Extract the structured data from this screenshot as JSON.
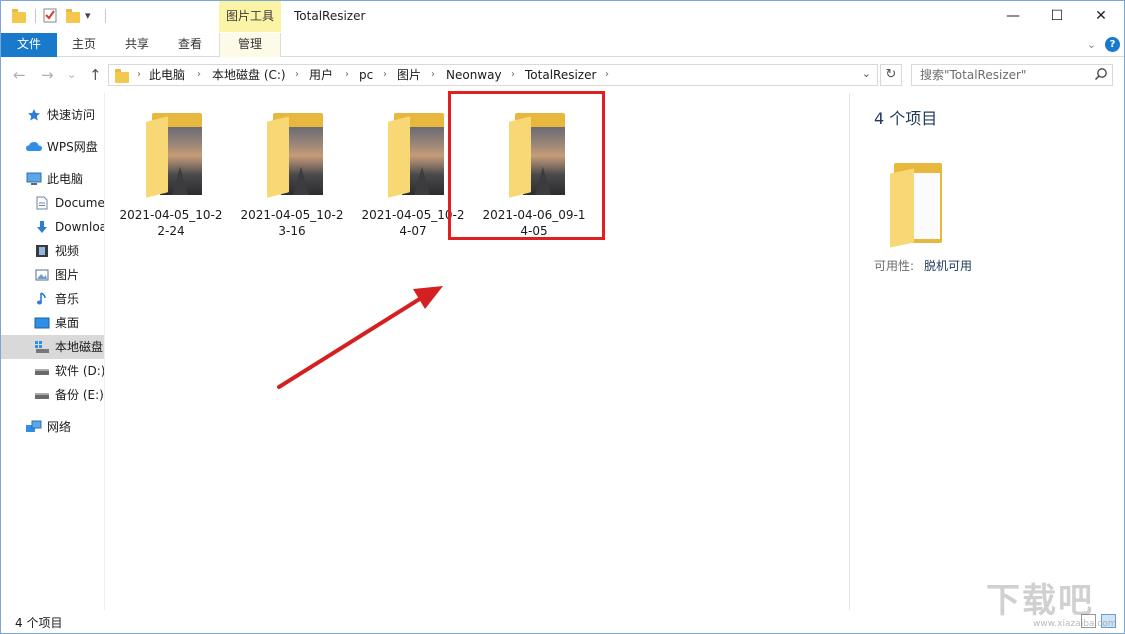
{
  "window": {
    "title": "TotalResizer",
    "contextual_tab": "图片工具",
    "minimize_glyph": "—",
    "maximize_glyph": "☐",
    "close_glyph": "✕",
    "quick_access_dropdown": "▾"
  },
  "ribbon": {
    "tabs": [
      "文件",
      "主页",
      "共享",
      "查看",
      "管理"
    ],
    "collapse_glyph": "⌄",
    "help_glyph": "?"
  },
  "nav": {
    "back": "←",
    "forward": "→",
    "recent": "⌄",
    "up": "↑",
    "breadcrumbs": [
      "此电脑",
      "本地磁盘 (C:)",
      "用户",
      "pc",
      "图片",
      "Neonway",
      "TotalResizer"
    ],
    "separator": "›",
    "dropdown_glyph": "⌄",
    "refresh_glyph": "↻",
    "search_placeholder": "搜索\"TotalResizer\""
  },
  "sidebar": {
    "items": [
      {
        "label": "快速访问",
        "icon": "star-icon"
      },
      {
        "label": "WPS网盘",
        "icon": "cloud-icon"
      },
      {
        "label": "此电脑",
        "icon": "computer-icon"
      },
      {
        "label": "Documents",
        "icon": "document-icon"
      },
      {
        "label": "Downloads",
        "icon": "download-icon"
      },
      {
        "label": "视频",
        "icon": "video-icon"
      },
      {
        "label": "图片",
        "icon": "pictures-icon"
      },
      {
        "label": "音乐",
        "icon": "music-icon"
      },
      {
        "label": "桌面",
        "icon": "desktop-icon"
      },
      {
        "label": "本地磁盘 (C:)",
        "icon": "system-drive-icon"
      },
      {
        "label": "软件 (D:)",
        "icon": "drive-icon"
      },
      {
        "label": "备份 (E:)",
        "icon": "drive-icon"
      },
      {
        "label": "网络",
        "icon": "network-icon"
      }
    ],
    "selected_index": 9
  },
  "files": [
    {
      "name": "2021-04-05_10-22-24"
    },
    {
      "name": "2021-04-05_10-23-16"
    },
    {
      "name": "2021-04-05_10-24-07"
    },
    {
      "name": "2021-04-06_09-14-05"
    }
  ],
  "details": {
    "count": "4 个项目",
    "availability_label": "可用性:",
    "availability_value": "脱机可用"
  },
  "status": {
    "text": "4 个项目"
  },
  "watermark": {
    "text": "下载吧",
    "url": "www.xiazaiba.com"
  },
  "colors": {
    "file_tab": "#1979ca",
    "contextual_tab": "#fbf3a6",
    "highlight": "#e02020",
    "annotation_arrow": "#d42020",
    "folder": "#f8d775"
  }
}
